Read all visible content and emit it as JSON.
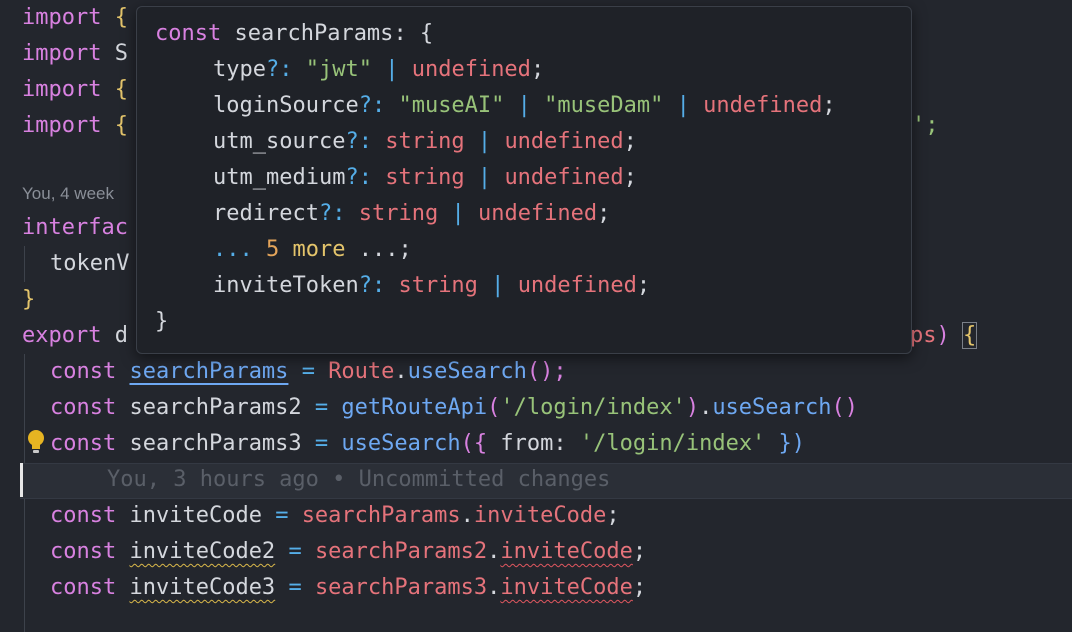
{
  "editor": {
    "imports": [
      {
        "kw": "import",
        "rest": " {"
      },
      {
        "kw": "import",
        "rest": " S"
      },
      {
        "kw": "import",
        "rest": " {"
      },
      {
        "kw": "import",
        "rest": " {",
        "tail": "';"
      }
    ],
    "blame_top": "You, 4 week",
    "interface_kw": "interfac",
    "interface_member": "tokenV",
    "close_brace": "}",
    "export_line": {
      "kw": "export",
      "rest": " d",
      "tail_var": "ps",
      "tail_paren": ")",
      "tail_brace": "{"
    },
    "line_search1": {
      "kw": "const",
      "name": "searchParams",
      "eq": "=",
      "obj": "Route",
      "method": "useSearch",
      "end": "();"
    },
    "line_search2": {
      "kw": "const",
      "name": "searchParams2",
      "eq": "=",
      "fn": "getRouteApi",
      "arg": "'/login/index'",
      "method": "useSearch",
      "end": "()"
    },
    "line_search3": {
      "kw": "const",
      "name": "searchParams3",
      "eq": "=",
      "fn": "useSearch",
      "open": "({ ",
      "prop": "from",
      "colon": ": ",
      "arg": "'/login/index'",
      "close": " })"
    },
    "ghost_blame": "You, 3 hours ago • Uncommitted changes",
    "line_invite1": {
      "kw": "const",
      "name": "inviteCode",
      "eq": "=",
      "obj": "searchParams",
      "prop": "inviteCode",
      "end": ";"
    },
    "line_invite2": {
      "kw": "const",
      "name": "inviteCode2",
      "eq": "=",
      "obj": "searchParams2",
      "prop": "inviteCode",
      "end": ";"
    },
    "line_invite3": {
      "kw": "const",
      "name": "inviteCode3",
      "eq": "=",
      "obj": "searchParams3",
      "prop": "inviteCode",
      "end": ";"
    }
  },
  "hover": {
    "header_kw": "const",
    "header_name": "searchParams",
    "header_rest": ": {",
    "fields": [
      {
        "name": "type",
        "opt": "?:",
        "parts": [
          {
            "t": "\"jwt\"",
            "c": "str"
          },
          {
            "t": " | ",
            "c": "op"
          },
          {
            "t": "undefined",
            "c": "var"
          },
          {
            "t": ";",
            "c": "plain"
          }
        ]
      },
      {
        "name": "loginSource",
        "opt": "?:",
        "parts": [
          {
            "t": "\"museAI\"",
            "c": "str"
          },
          {
            "t": " | ",
            "c": "op"
          },
          {
            "t": "\"museDam\"",
            "c": "str"
          },
          {
            "t": " | ",
            "c": "op"
          },
          {
            "t": "undefined",
            "c": "var"
          },
          {
            "t": ";",
            "c": "plain"
          }
        ]
      },
      {
        "name": "utm_source",
        "opt": "?:",
        "parts": [
          {
            "t": "string",
            "c": "var"
          },
          {
            "t": " | ",
            "c": "op"
          },
          {
            "t": "undefined",
            "c": "var"
          },
          {
            "t": ";",
            "c": "plain"
          }
        ]
      },
      {
        "name": "utm_medium",
        "opt": "?:",
        "parts": [
          {
            "t": "string",
            "c": "var"
          },
          {
            "t": " | ",
            "c": "op"
          },
          {
            "t": "undefined",
            "c": "var"
          },
          {
            "t": ";",
            "c": "plain"
          }
        ]
      },
      {
        "name": "redirect",
        "opt": "?:",
        "parts": [
          {
            "t": "string",
            "c": "var"
          },
          {
            "t": " | ",
            "c": "op"
          },
          {
            "t": "undefined",
            "c": "var"
          },
          {
            "t": ";",
            "c": "plain"
          }
        ]
      }
    ],
    "more": {
      "dots1": "...",
      "count": " 5 ",
      "word": "more",
      "dots2": " ...",
      "semi": ";"
    },
    "last_field": {
      "name": "inviteToken",
      "opt": "?:",
      "parts": [
        {
          "t": "string",
          "c": "var"
        },
        {
          "t": " | ",
          "c": "op"
        },
        {
          "t": "undefined",
          "c": "var"
        },
        {
          "t": ";",
          "c": "plain"
        }
      ]
    },
    "footer": "}"
  },
  "icons": {
    "bulb": "lightbulb-icon"
  },
  "colors": {
    "keyword": "#d881e0",
    "function": "#6ea8f2",
    "string": "#98c379",
    "variable": "#e5737b",
    "operator": "#55aee8",
    "brace": "#e3c46b"
  }
}
